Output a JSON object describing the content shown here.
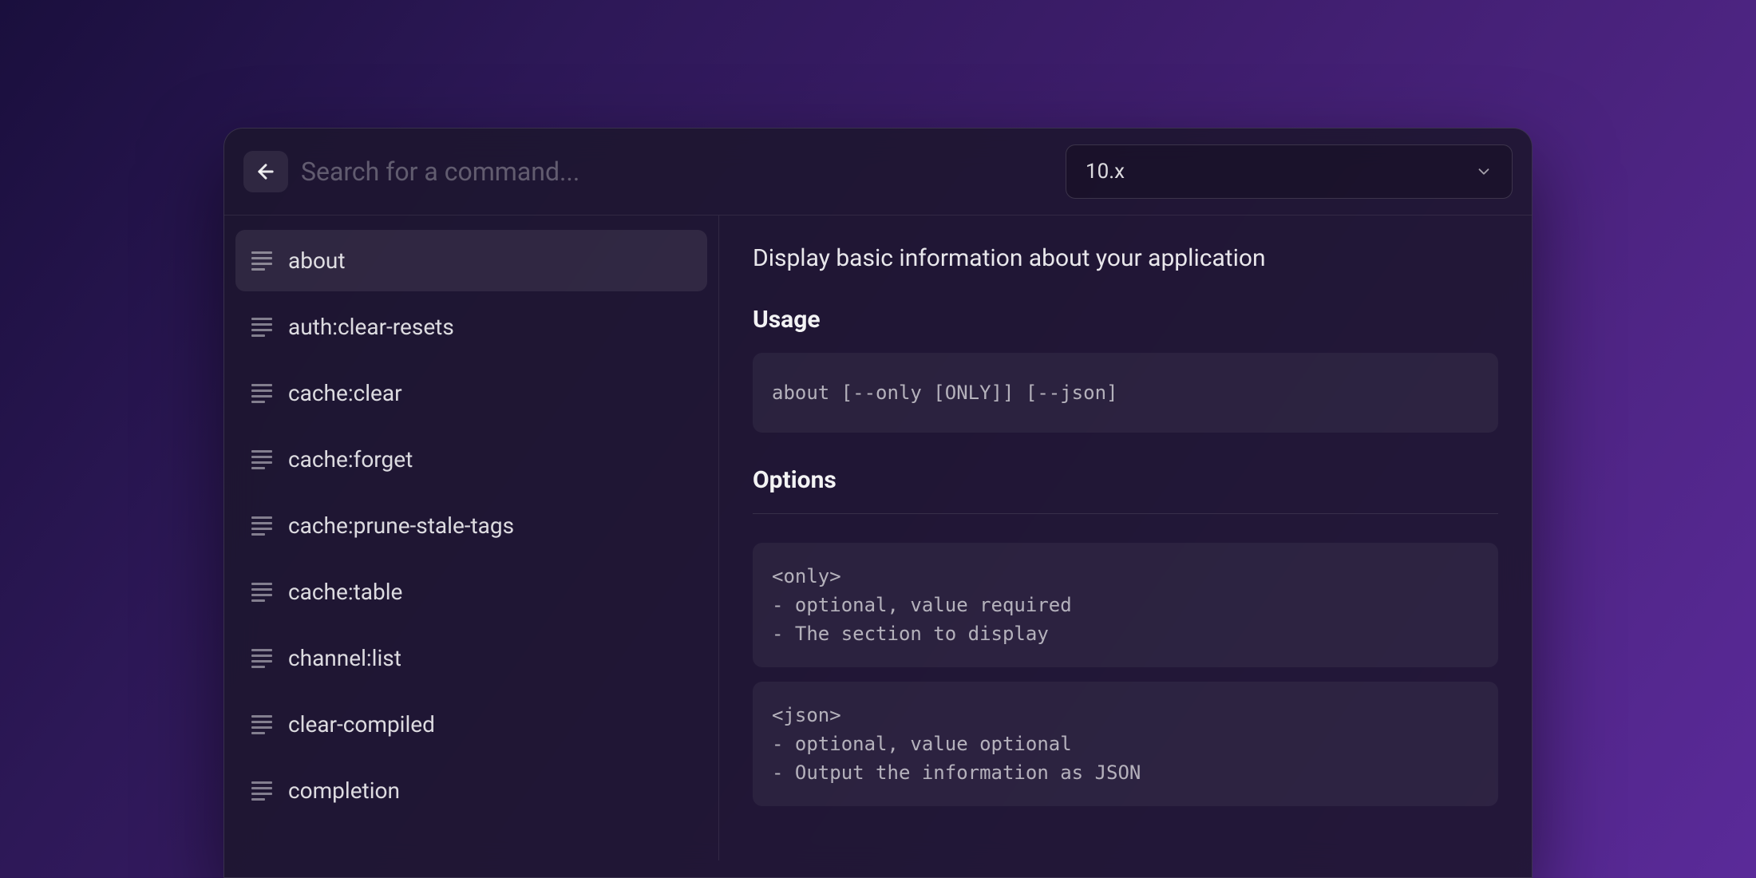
{
  "header": {
    "search_placeholder": "Search for a command...",
    "version_selected": "10.x"
  },
  "sidebar": {
    "items": [
      {
        "label": "about",
        "active": true
      },
      {
        "label": "auth:clear-resets",
        "active": false
      },
      {
        "label": "cache:clear",
        "active": false
      },
      {
        "label": "cache:forget",
        "active": false
      },
      {
        "label": "cache:prune-stale-tags",
        "active": false
      },
      {
        "label": "cache:table",
        "active": false
      },
      {
        "label": "channel:list",
        "active": false
      },
      {
        "label": "clear-compiled",
        "active": false
      },
      {
        "label": "completion",
        "active": false
      }
    ]
  },
  "main": {
    "description": "Display basic information about your application",
    "usage_title": "Usage",
    "usage_code": "about [--only [ONLY]] [--json]",
    "options_title": "Options",
    "options": [
      "<only>\n- optional, value required\n- The section to display",
      "<json>\n- optional, value optional\n- Output the information as JSON"
    ]
  }
}
